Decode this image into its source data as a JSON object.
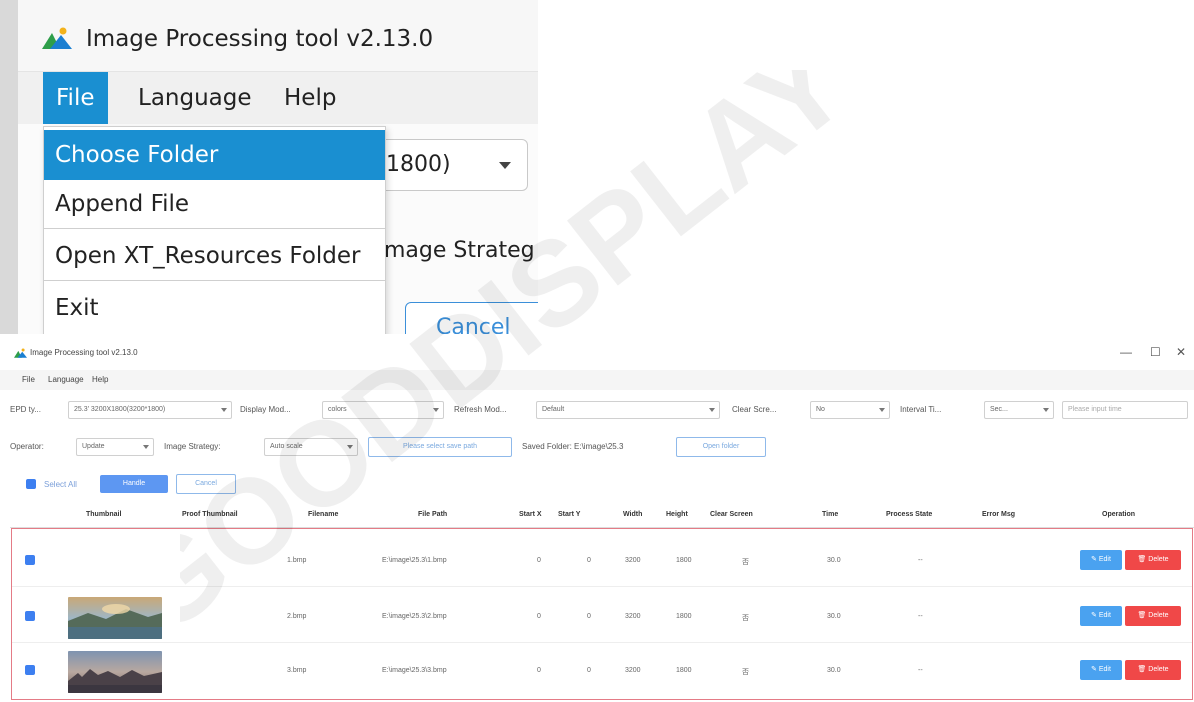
{
  "app": {
    "title": "Image Processing tool v2.13.0"
  },
  "menu": {
    "file": "File",
    "language": "Language",
    "help": "Help"
  },
  "file_menu": {
    "items": [
      "Choose Folder",
      "Append File",
      "Open XT_Resources Folder",
      "Exit"
    ]
  },
  "zoom_bg": {
    "combo_partial": "1800)",
    "strategy_partial": "mage Strateg",
    "cancel_partial": "Cancel"
  },
  "window_controls": {
    "minimize": "—",
    "maximize": "☐",
    "close": "✕"
  },
  "toolbar1": {
    "epd_label": "EPD ty...",
    "epd_value": "25.3' 3200X1800(3200*1800)",
    "display_mode_label": "Display Mod...",
    "display_mode_value": "colors",
    "refresh_mode_label": "Refresh Mod...",
    "refresh_mode_value": "Default",
    "clear_screen_label": "Clear Scre...",
    "clear_screen_value": "No",
    "interval_label": "Interval Ti...",
    "interval_value": "Sec...",
    "interval_placeholder": "Please input time"
  },
  "toolbar2": {
    "operator_label": "Operator:",
    "operator_value": "Update",
    "strategy_label": "Image Strategy:",
    "strategy_value": "Auto scale",
    "save_path_button": "Please select save path",
    "saved_folder_text": "Saved Folder: E:\\image\\25.3",
    "open_folder_button": "Open folder"
  },
  "toolbar3": {
    "select_all": "Select All",
    "handle_button": "Handle",
    "cancel_button": "Cancel"
  },
  "table": {
    "columns": [
      "Thumbnail",
      "Proof Thumbnail",
      "Filename",
      "File Path",
      "Start X",
      "Start Y",
      "Width",
      "Height",
      "Clear Screen",
      "Time",
      "Process State",
      "Error Msg",
      "Operation"
    ],
    "rows": [
      {
        "filename": "1.bmp",
        "path": "E:\\image\\25.3\\1.bmp",
        "start_x": "0",
        "start_y": "0",
        "width": "3200",
        "height": "1800",
        "clear": "否",
        "time": "30.0",
        "state": "--",
        "thumb": "none"
      },
      {
        "filename": "2.bmp",
        "path": "E:\\image\\25.3\\2.bmp",
        "start_x": "0",
        "start_y": "0",
        "width": "3200",
        "height": "1800",
        "clear": "否",
        "time": "30.0",
        "state": "--",
        "thumb": "landscape-lake"
      },
      {
        "filename": "3.bmp",
        "path": "E:\\image\\25.3\\3.bmp",
        "start_x": "0",
        "start_y": "0",
        "width": "3200",
        "height": "1800",
        "clear": "否",
        "time": "30.0",
        "state": "--",
        "thumb": "landscape-city"
      }
    ],
    "edit_label": "Edit",
    "delete_label": "Delete"
  },
  "watermark": {
    "text": "GOODDISPLAY"
  },
  "colors": {
    "menu_active": "#1a8fd1",
    "primary_button": "#5d97f2",
    "delete_button": "#f04848",
    "edit_button": "#4aa2f0",
    "selection_border": "#e47b86"
  }
}
